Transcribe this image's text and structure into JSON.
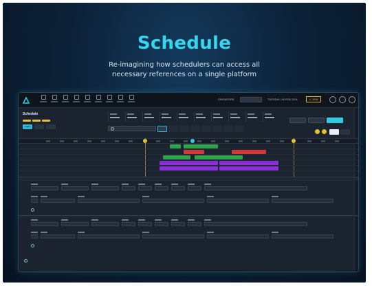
{
  "hero": {
    "title": "Schedule",
    "subtitle": "Re-imagining how schedulers can access all necessary references on a single platform"
  },
  "topbar": {
    "env_label": "SINGAPORE",
    "env_value": "",
    "date_label": "TUESDAY, 06 FEB 2024",
    "warning": "⚠ 1036"
  },
  "schedule": {
    "title": "Schedule",
    "tabs": [
      "Flight",
      "",
      ""
    ],
    "search_value": "",
    "buttons": [
      "",
      "",
      ""
    ],
    "small_buttons": [
      "",
      ""
    ]
  },
  "gantt": {
    "rows": [
      "",
      "",
      "",
      "",
      ""
    ],
    "bars": [
      {
        "label": "",
        "color": "#2fa14a"
      },
      {
        "label": "",
        "color": "#2fa14a"
      },
      {
        "label": "",
        "color": "#d23a3a"
      },
      {
        "label": "",
        "color": "#d23a3a"
      },
      {
        "label": "",
        "color": "#2fa14a"
      },
      {
        "label": "",
        "color": "#2fa14a"
      },
      {
        "label": "",
        "color": "#8a2fd6"
      },
      {
        "label": "",
        "color": "#8a2fd6"
      },
      {
        "label": "",
        "color": "#8a2fd6"
      },
      {
        "label": "",
        "color": "#8a2fd6"
      }
    ]
  },
  "form": {
    "section_title": "",
    "section_action": "",
    "add_rows": [
      "",
      "",
      ""
    ]
  },
  "colors": {
    "accent": "#2fcbe3",
    "warning": "#e6c23a",
    "green": "#2fa14a",
    "red": "#d23a3a",
    "purple": "#8a2fd6"
  }
}
